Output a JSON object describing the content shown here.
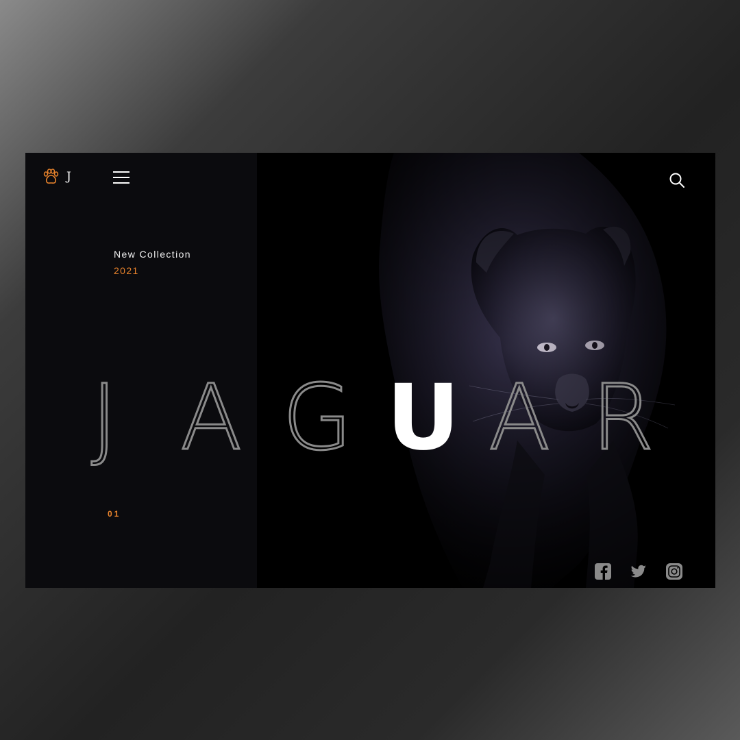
{
  "brand": {
    "logo_icon": "paw-icon",
    "letter": "J",
    "accent_color": "#e8832c"
  },
  "header": {
    "menu_icon": "hamburger-icon",
    "search_icon": "search-icon"
  },
  "hero": {
    "collection_label": "New Collection",
    "collection_year": "2021",
    "headline_letters": [
      "J",
      "A",
      "G",
      "U",
      "A",
      "R"
    ],
    "highlight_letter": "U",
    "slide_index": "01"
  },
  "social": [
    {
      "name": "facebook",
      "icon": "facebook-icon"
    },
    {
      "name": "twitter",
      "icon": "twitter-icon"
    },
    {
      "name": "instagram",
      "icon": "instagram-icon"
    }
  ]
}
